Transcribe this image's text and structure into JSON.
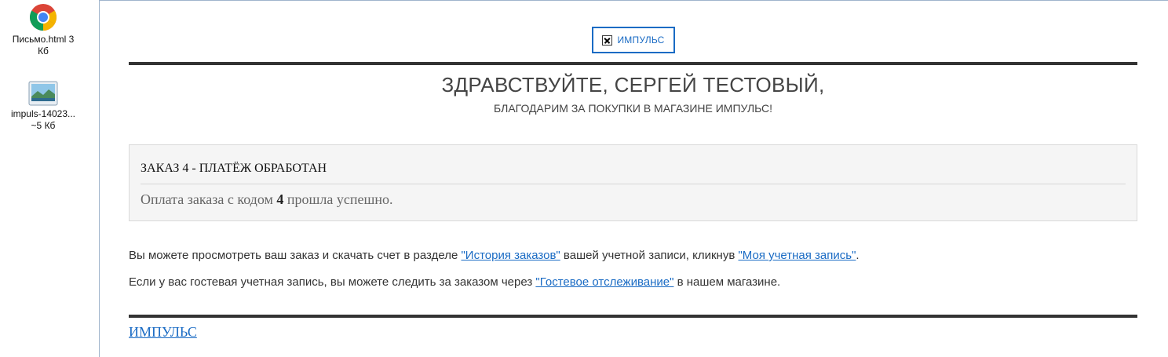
{
  "attachments": [
    {
      "name": "Письмо.html 3",
      "size": "Кб",
      "icon": "chrome-icon"
    },
    {
      "name": "impuls-14023...",
      "size": "~5 Кб",
      "icon": "image-file-icon"
    }
  ],
  "logo": {
    "text": "ИМПУЛЬС",
    "icon": "broken-image-icon"
  },
  "greeting": {
    "title": "ЗДРАВСТВУЙТЕ, СЕРГЕЙ ТЕСТОВЫЙ,",
    "subtitle": "БЛАГОДАРИМ ЗА ПОКУПКИ В МАГАЗИНЕ ИМПУЛЬС!"
  },
  "order": {
    "title": "ЗАКАЗ 4 - ПЛАТЁЖ ОБРАБОТАН",
    "message_before": "Оплата заказа с кодом ",
    "order_code": "4",
    "message_after": " прошла успешно."
  },
  "info": {
    "line1_before": "Вы можете просмотреть ваш заказ и скачать счет в разделе ",
    "link_history": "\"История заказов\"",
    "line1_middle": " вашей учетной записи, кликнув ",
    "link_account": "\"Моя учетная запись\"",
    "line1_after": ".",
    "line2_before": "Если у вас гостевая учетная запись, вы можете следить за заказом через ",
    "link_guest": "\"Гостевое отслеживание\"",
    "line2_after": " в нашем магазине."
  },
  "footer": {
    "link": "ИМПУЛЬС"
  },
  "colors": {
    "link": "#1a6bc4",
    "rule": "#333333",
    "order_box_bg": "#f5f5f5",
    "sidebar_border": "#9fb4cc"
  }
}
